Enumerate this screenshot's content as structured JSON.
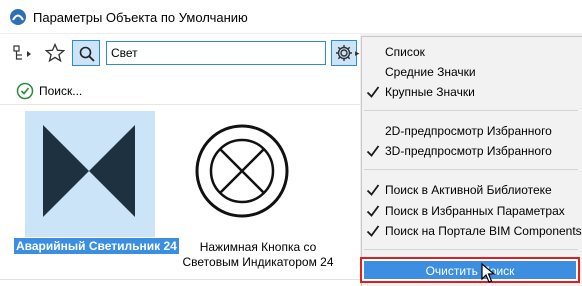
{
  "window": {
    "title": "Параметры Объекта по Умолчанию"
  },
  "toolbar": {
    "search_value": "Свет",
    "icons": [
      "tree-view-icon",
      "star-icon",
      "search-icon",
      "gear-icon"
    ]
  },
  "search_row": {
    "label": "Поиск..."
  },
  "results": [
    {
      "label": "Аварийный Светильник 24",
      "selected": true
    },
    {
      "label_line1": "Нажимная Кнопка со",
      "label_line2": "Световым Индикатором 24",
      "selected": false
    }
  ],
  "menu": {
    "view_items": [
      {
        "label": "Список",
        "checked": false
      },
      {
        "label": "Средние Значки",
        "checked": false
      },
      {
        "label": "Крупные Значки",
        "checked": true
      }
    ],
    "preview_items": [
      {
        "label": "2D-предпросмотр Избранного",
        "checked": false
      },
      {
        "label": "3D-предпросмотр Избранного",
        "checked": true
      }
    ],
    "search_items": [
      {
        "label": "Поиск в Активной Библиотеке",
        "checked": true
      },
      {
        "label": "Поиск в Избранных Параметрах",
        "checked": true
      },
      {
        "label": "Поиск на Портале BIM Components",
        "checked": true
      }
    ],
    "clear_search": "Очистить Поиск"
  },
  "colors": {
    "selection": "#3b8ee0",
    "selection_light": "#cce4f7",
    "highlight_border": "#e02020"
  }
}
